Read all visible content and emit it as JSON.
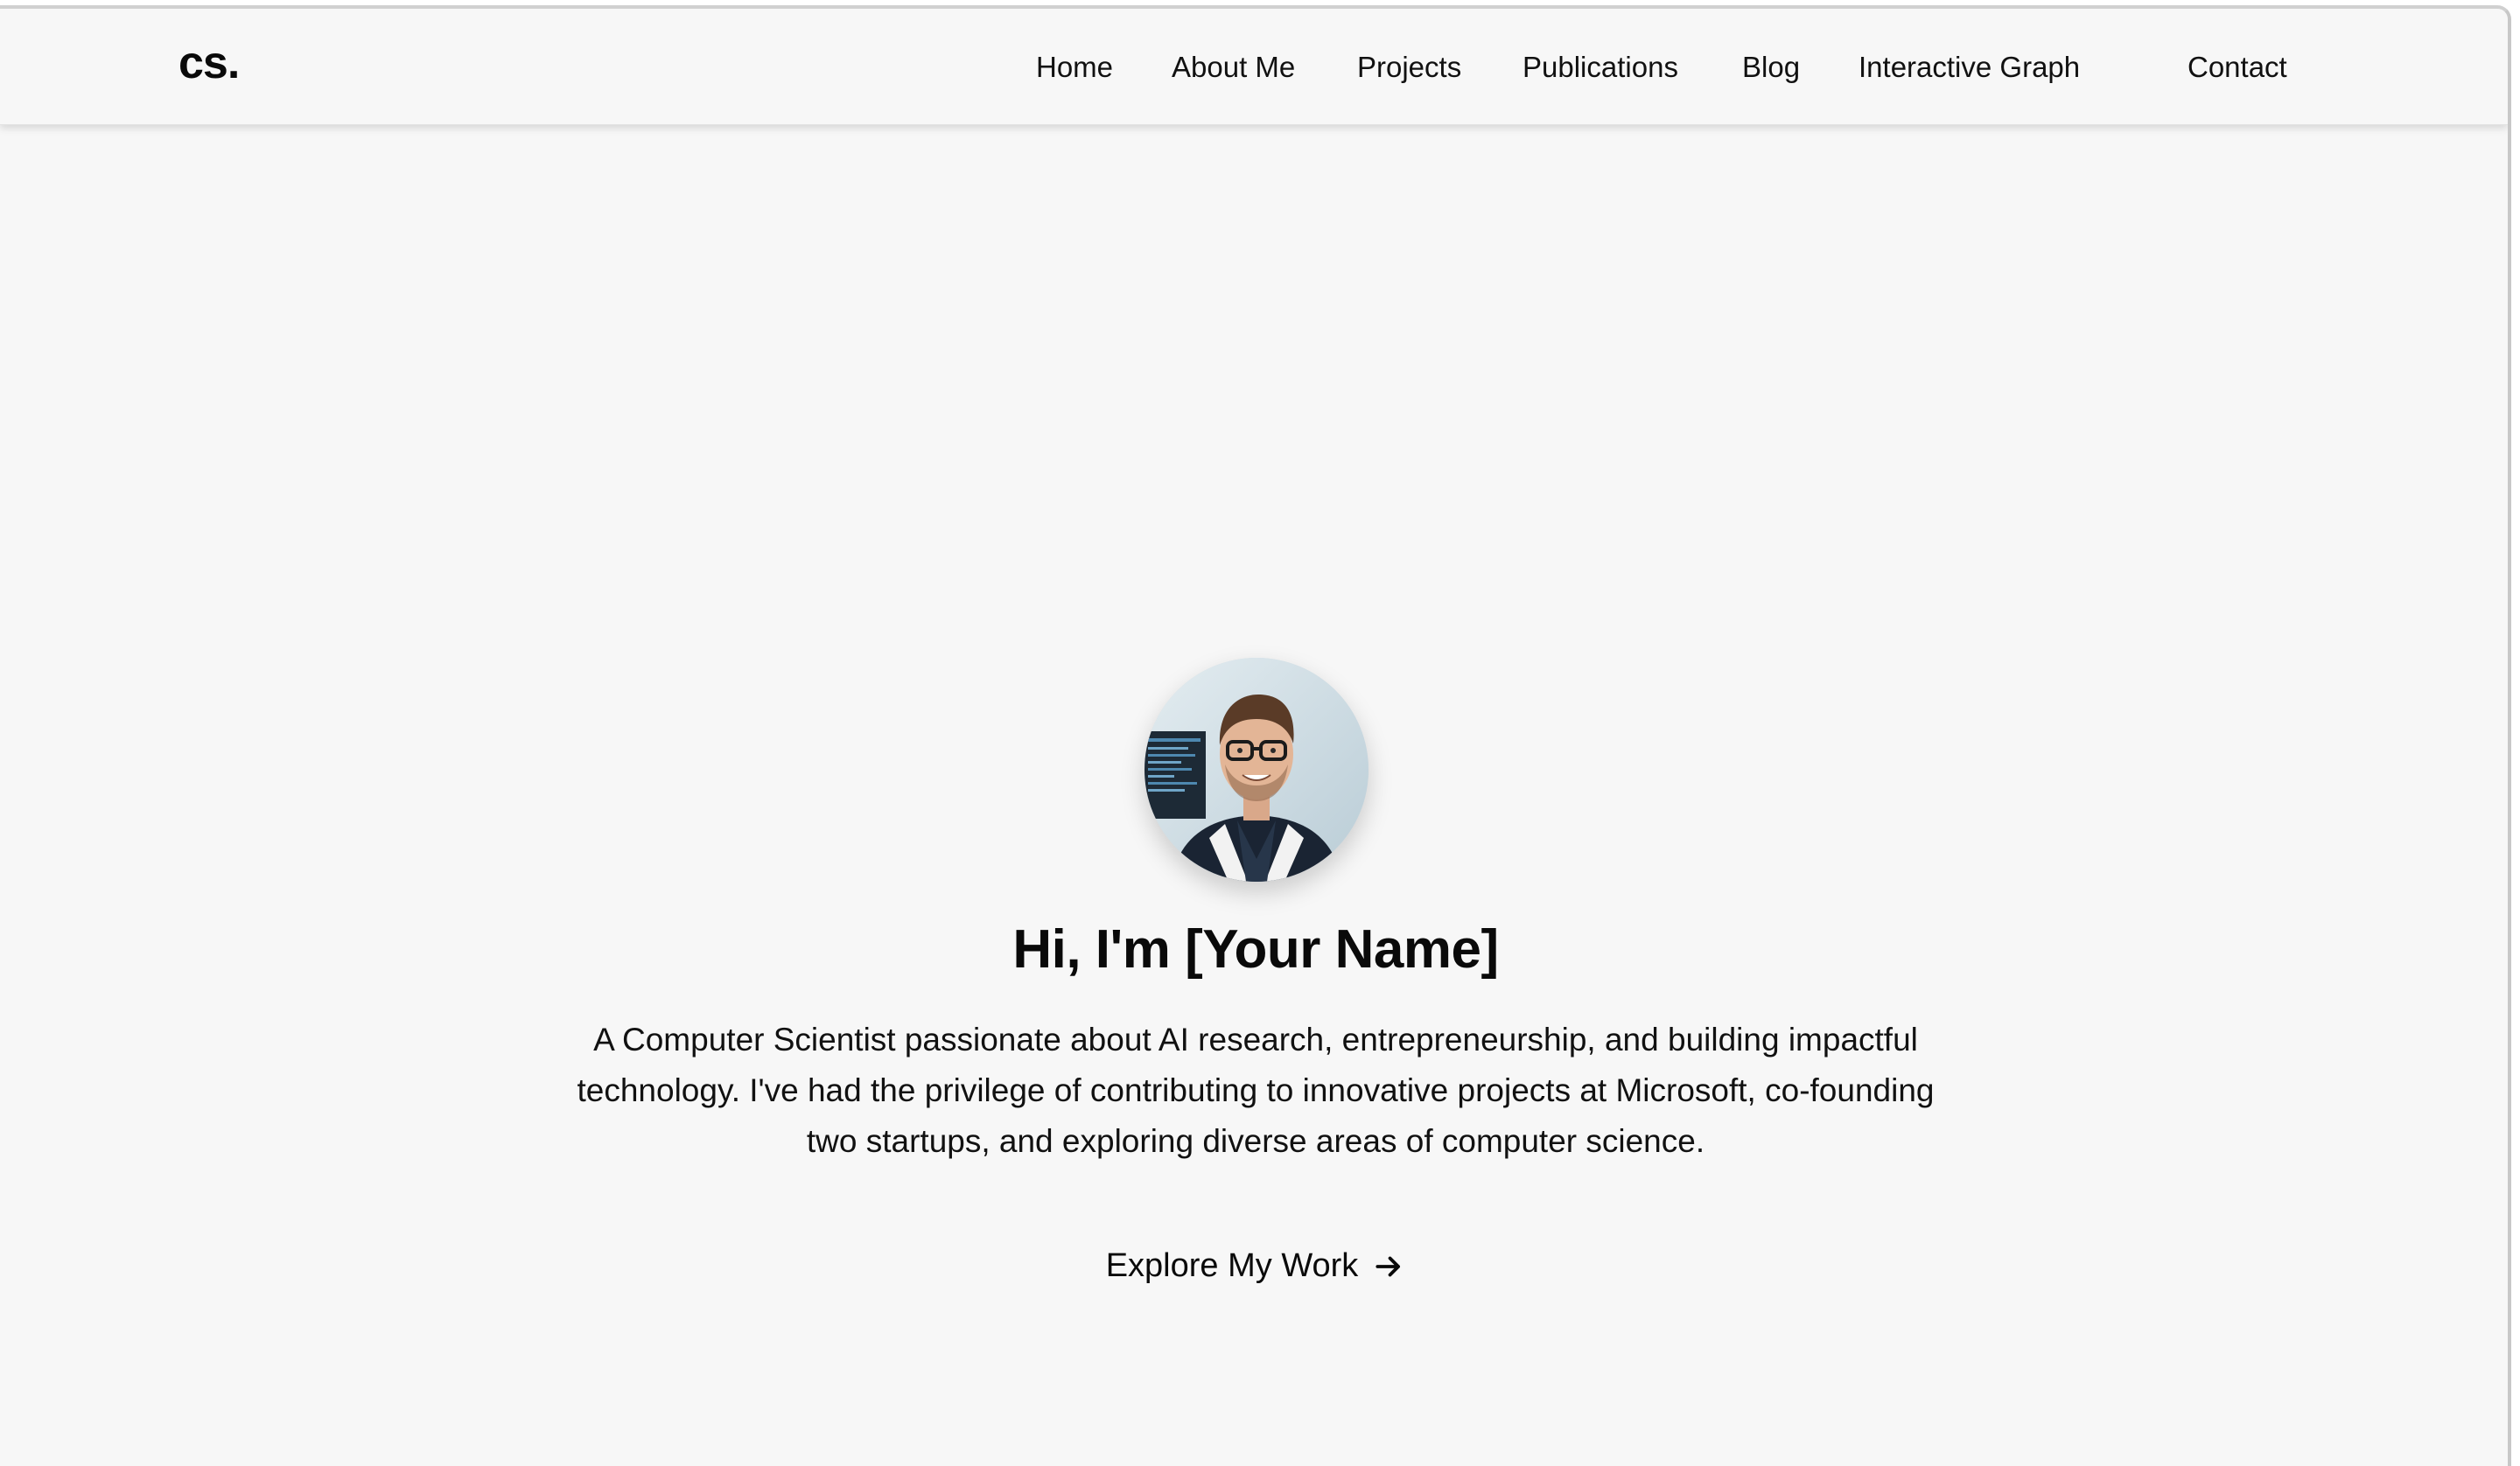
{
  "header": {
    "logo": "cs.",
    "nav": [
      {
        "label": "Home"
      },
      {
        "label": "About Me"
      },
      {
        "label": "Projects"
      },
      {
        "label": "Publications"
      },
      {
        "label": "Blog"
      },
      {
        "label": "Interactive Graph"
      },
      {
        "label": "Contact"
      }
    ]
  },
  "hero": {
    "avatar_icon": "profile-photo",
    "title": "Hi, I'm [Your Name]",
    "description": "A Computer Scientist passionate about AI research, entrepreneurship, and building impactful technology. I've had the privilege of contributing to innovative projects at Microsoft, co-founding two startups, and exploring diverse areas of computer science.",
    "cta_label": "Explore My Work",
    "cta_icon": "arrow-right-icon"
  },
  "colors": {
    "background": "#f7f7f7",
    "text": "#111111"
  }
}
